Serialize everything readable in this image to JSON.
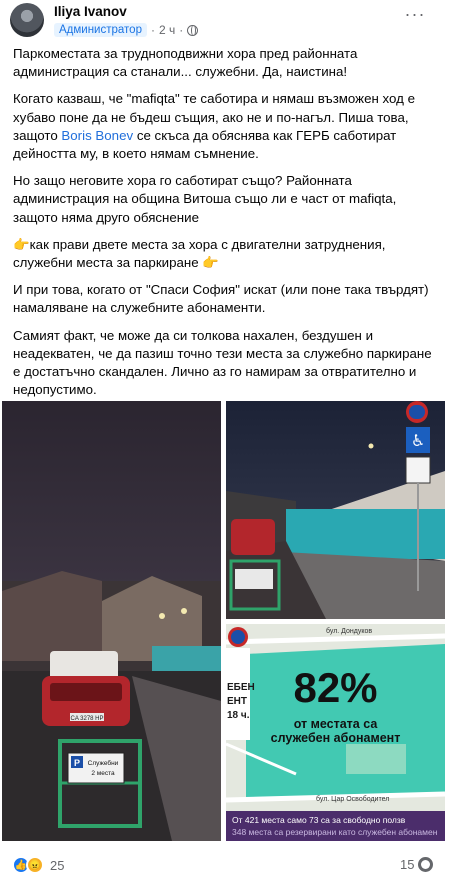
{
  "post": {
    "author": "Iliya Ivanov",
    "role": "Администратор",
    "time": "2 ч",
    "separator": "·",
    "more_label": "···",
    "paragraphs": [
      {
        "text": "Паркоместата за трудноподвижни хора пред районната администрация са станали... служебни. Да, наистина!"
      },
      {
        "before": "Когато казваш, че \"mafiqta\" те саботира и нямаш възможен ход е хубаво поне да не бъдеш същия, ако не и по-нагъл. Пиша това, защото ",
        "mention": "Boris Bonev",
        "after": " се скъса да обяснява как ГЕРБ саботират дейността му, в което нямам съмнение."
      },
      {
        "text": "Но защо неговите хора го саботират също? Районната администрация на община Витоша също ли е част от mafiqta, защото няма друго обяснение"
      },
      {
        "emoji": "👉",
        "text": "как прави двете места за хора с двигателни затруднения, служебни места за паркиране ",
        "emoji_end": "👉"
      },
      {
        "text": "И при това, когато от \"Спаси София\" искат (или поне така твърдят) намаляване на служебните абонаменти."
      },
      {
        "text": "Самият факт, че може да си толкова нахален, бездушен и неадекватен, че да пазиш точно тези места за служебно паркиране е достатъчно скандален. Лично аз го намирам за отвратително и недопустимо."
      }
    ]
  },
  "photos": {
    "sign_label": "Служебни\n2 места",
    "plate": "CA 3278 HP",
    "map": {
      "stat": "82%",
      "stat_line1": "от местата са",
      "stat_line2": "служебен абонамент",
      "street1": "бул. Дондуков",
      "street2": "бул. Цар Освободител",
      "side_sign_1": "ЕБЕН",
      "side_sign_2": "ЕНТ",
      "side_sign_3": "18 ч.",
      "footer_line1": "От 421 места само 73 са за свободно ползв",
      "footer_line2": "348 места са резервирани като служебен абонамен"
    }
  },
  "footer": {
    "reaction_count": "25",
    "comment_count": "15"
  },
  "colors": {
    "link": "#216fdb",
    "secondary_text": "#65676b",
    "badge_bg": "#e7f3ff",
    "badge_text": "#1b74e4",
    "like": "#1877f2",
    "angry": "#f7b125",
    "map_footer": "#4b2d6b"
  },
  "icons": [
    "avatar",
    "globe-icon",
    "more-icon",
    "like-icon",
    "angry-icon",
    "comment-icon"
  ]
}
